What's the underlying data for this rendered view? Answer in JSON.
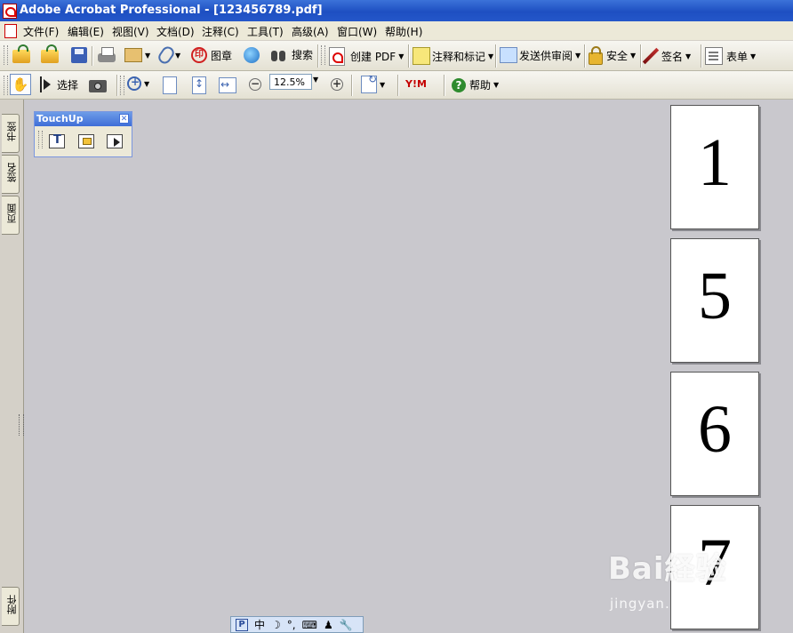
{
  "window": {
    "title": "Adobe Acrobat Professional - [123456789.pdf]"
  },
  "menu": {
    "items": [
      "文件(F)",
      "编辑(E)",
      "视图(V)",
      "文档(D)",
      "注释(C)",
      "工具(T)",
      "高级(A)",
      "窗口(W)",
      "帮助(H)"
    ]
  },
  "toolbar1": {
    "stamp_label": "图章",
    "search_label": "搜索",
    "create_pdf_label": "创建 PDF",
    "comment_label": "注释和标记",
    "review_label": "发送供审阅",
    "security_label": "安全",
    "sign_label": "签名",
    "forms_label": "表单"
  },
  "toolbar2": {
    "select_label": "选择",
    "zoom_value": "12.5%",
    "yahoo_label": "Y!M",
    "help_label": "帮助"
  },
  "touchup": {
    "title": "TouchUp"
  },
  "nav_tabs": {
    "bookmarks": "书签",
    "signatures": "签名",
    "pages": "页面",
    "attachments": "附件"
  },
  "pages": [
    "1",
    "5",
    "6",
    "7"
  ],
  "watermark": {
    "logo": "Bai経验",
    "url": "jingyan.baidu.com"
  },
  "ime": {
    "p": "P",
    "zh": "中"
  },
  "colors": {
    "titlebar": "#2457c9",
    "workspace": "#c9c8cd",
    "toolbar": "#ece9d8"
  }
}
